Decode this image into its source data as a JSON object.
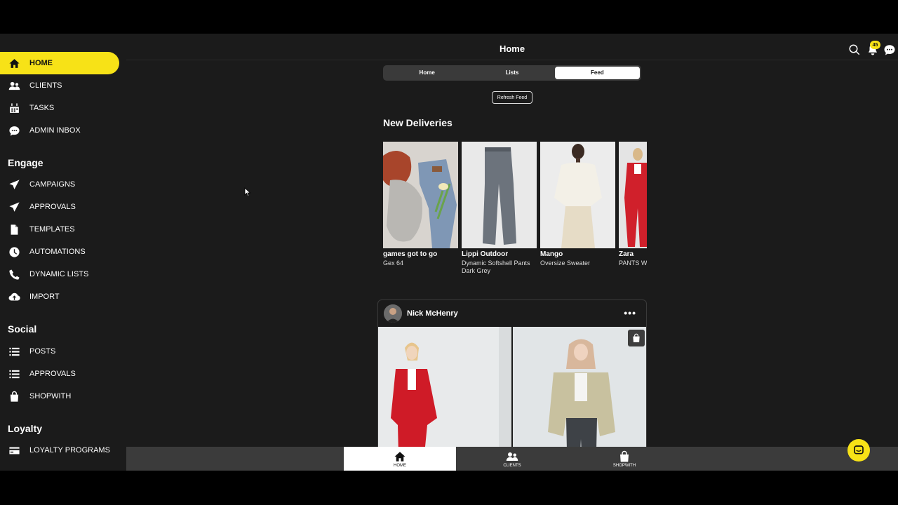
{
  "header": {
    "title": "Home",
    "notification_count": "45"
  },
  "sidebar": {
    "main_items": [
      {
        "label": "HOME",
        "icon": "home-icon",
        "active": true
      },
      {
        "label": "CLIENTS",
        "icon": "users-icon"
      },
      {
        "label": "TASKS",
        "icon": "calendar-icon"
      },
      {
        "label": "ADMIN INBOX",
        "icon": "chat-bubble-icon"
      }
    ],
    "engage": {
      "title": "Engage",
      "items": [
        {
          "label": "CAMPAIGNS",
          "icon": "paper-plane-icon"
        },
        {
          "label": "APPROVALS",
          "icon": "paper-plane-icon"
        },
        {
          "label": "TEMPLATES",
          "icon": "document-icon"
        },
        {
          "label": "AUTOMATIONS",
          "icon": "clock-icon"
        },
        {
          "label": "DYNAMIC LISTS",
          "icon": "phone-icon"
        },
        {
          "label": "IMPORT",
          "icon": "cloud-upload-icon"
        }
      ]
    },
    "social": {
      "title": "Social",
      "items": [
        {
          "label": "POSTS",
          "icon": "list-icon"
        },
        {
          "label": "APPROVALS",
          "icon": "list-icon"
        },
        {
          "label": "SHOPWITH",
          "icon": "shopping-bag-icon"
        }
      ]
    },
    "loyalty": {
      "title": "Loyalty",
      "items": [
        {
          "label": "LOYALTY PROGRAMS",
          "icon": "card-icon"
        }
      ]
    }
  },
  "tabs": [
    {
      "label": "Home"
    },
    {
      "label": "Lists"
    },
    {
      "label": "Feed",
      "active": true
    }
  ],
  "refresh_label": "Refresh Feed",
  "deliveries": {
    "title": "New Deliveries",
    "cards": [
      {
        "brand": "games got to go",
        "desc": "Gex 64"
      },
      {
        "brand": "Lippi Outdoor",
        "desc": "Dynamic Softshell Pants Dark Grey"
      },
      {
        "brand": "Mango",
        "desc": "Oversize Sweater"
      },
      {
        "brand": "Zara",
        "desc": "PANTS WITH COVERED"
      }
    ]
  },
  "post": {
    "author": "Nick McHenry",
    "more": "•••"
  },
  "bottom_nav": [
    {
      "label": "HOME",
      "icon": "home-icon",
      "active": true
    },
    {
      "label": "CLIENTS",
      "icon": "users-icon"
    },
    {
      "label": "SHOPWITH",
      "icon": "shopping-bag-icon"
    }
  ],
  "colors": {
    "accent": "#f7e217",
    "background": "#1b1b1b",
    "bottom_nav": "#3b3b3b"
  }
}
